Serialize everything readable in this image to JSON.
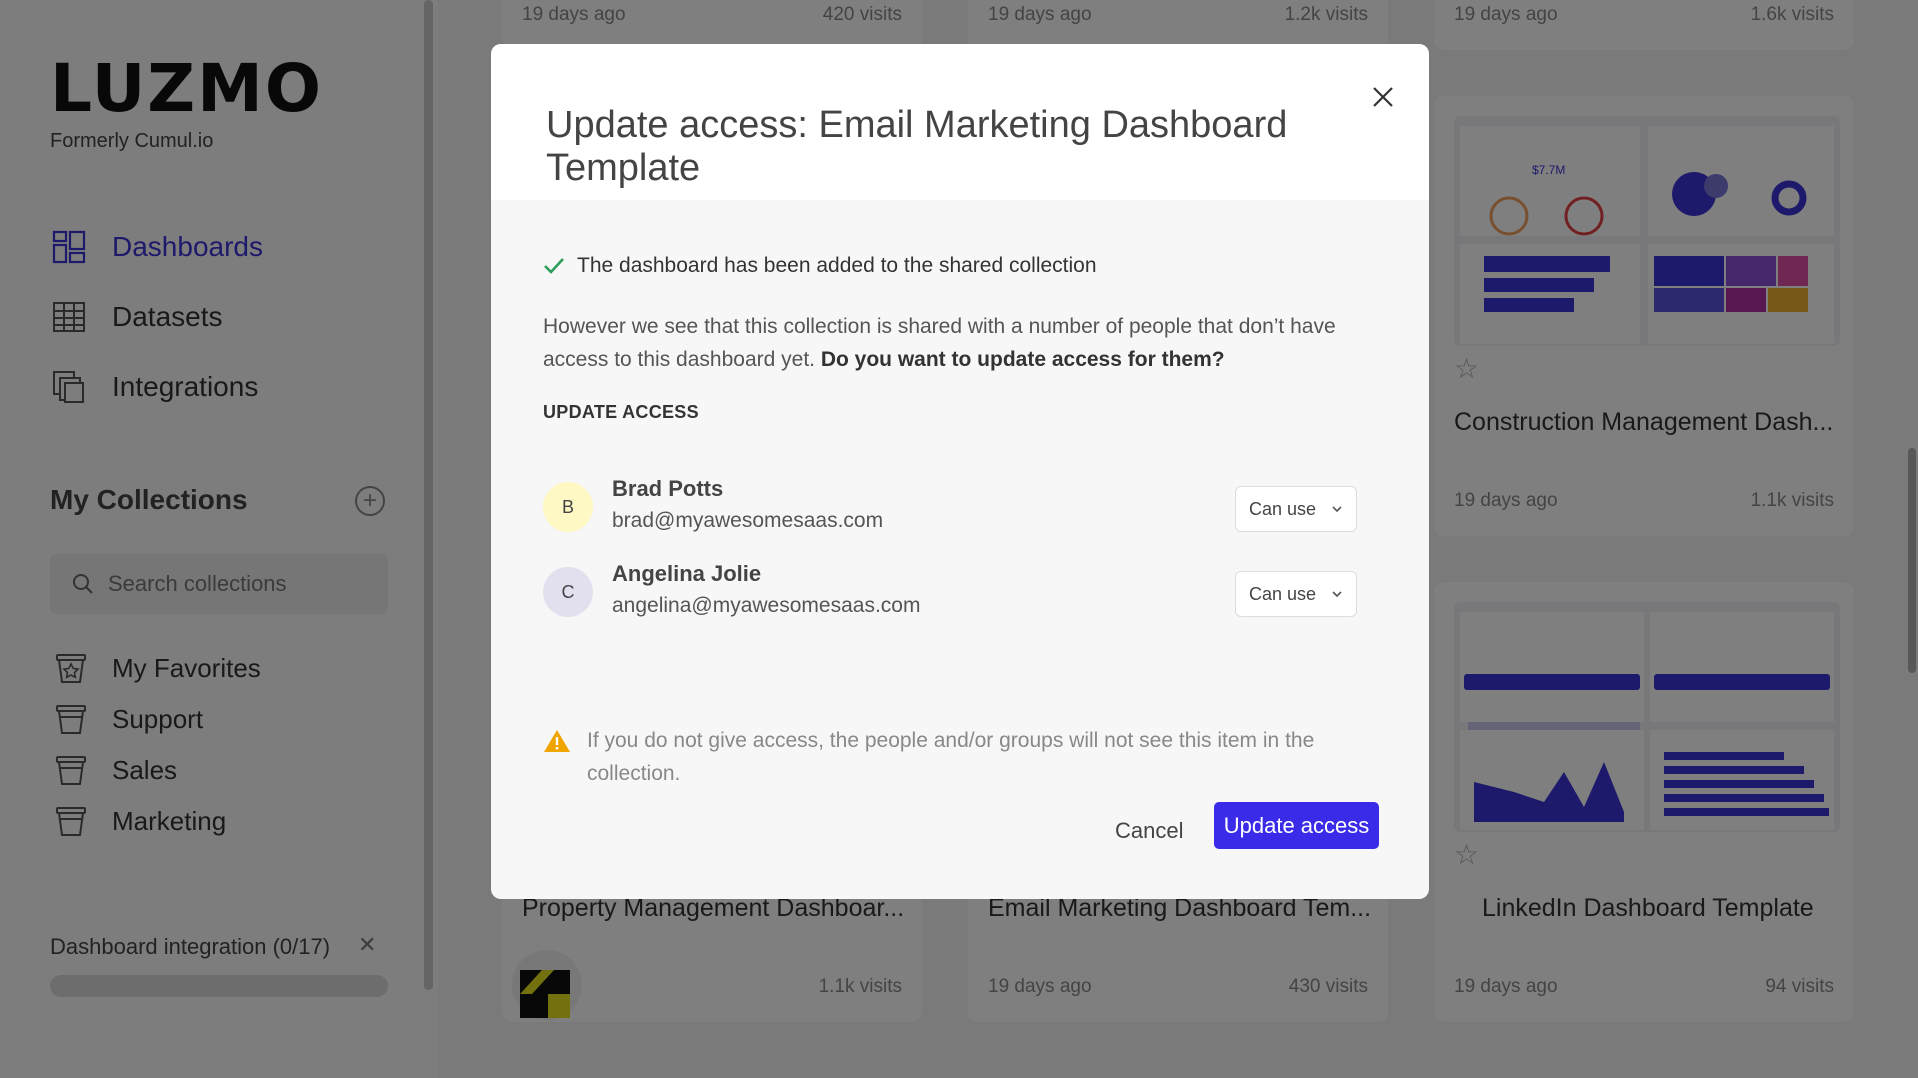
{
  "sidebar": {
    "logo": "LUZMO",
    "logo_sub": "Formerly Cumul.io",
    "nav": [
      {
        "label": "Dashboards",
        "icon": "dashboard-icon",
        "active": true
      },
      {
        "label": "Datasets",
        "icon": "table-icon",
        "active": false
      },
      {
        "label": "Integrations",
        "icon": "integrations-icon",
        "active": false
      }
    ],
    "collections_title": "My Collections",
    "search_placeholder": "Search collections",
    "collections": [
      {
        "label": "My Favorites",
        "icon": "favorites-basket-icon"
      },
      {
        "label": "Support",
        "icon": "basket-icon"
      },
      {
        "label": "Sales",
        "icon": "basket-icon"
      },
      {
        "label": "Marketing",
        "icon": "basket-icon"
      }
    ],
    "integration_label": "Dashboard integration (0/17)",
    "integration_progress": 0
  },
  "cards": {
    "top_row": [
      {
        "date": "19 days ago",
        "visits": "420 visits"
      },
      {
        "date": "19 days ago",
        "visits": "1.2k visits"
      },
      {
        "date": "19 days ago",
        "visits": "1.6k visits"
      }
    ],
    "construction": {
      "title": "Construction Management Dash...",
      "date": "19 days ago",
      "visits": "1.1k visits",
      "thumb_value": "$7.7M"
    },
    "bottom_row": [
      {
        "title": "Property Management Dashboar...",
        "date": "",
        "visits": "1.1k visits"
      },
      {
        "title": "Email Marketing Dashboard Tem...",
        "date": "19 days ago",
        "visits": "430 visits"
      },
      {
        "title": "LinkedIn Dashboard Template",
        "date": "19 days ago",
        "visits": "94 visits"
      }
    ]
  },
  "modal": {
    "title": "Update access: Email Marketing Dashboard Template",
    "success_message": "The dashboard has been added to the shared collection",
    "description": "However we see that this collection is shared with a number of people that don’t have access to this dashboard yet.",
    "description_strong": "Do you want to update access for them?",
    "section_label": "UPDATE ACCESS",
    "people": [
      {
        "initial": "B",
        "name": "Brad Potts",
        "email": "brad@myawesomesaas.com",
        "access": "Can use",
        "avatar_color": "#fdf8c4"
      },
      {
        "initial": "C",
        "name": "Angelina Jolie",
        "email": "angelina@myawesomesaas.com",
        "access": "Can use",
        "avatar_color": "#e2e0ef"
      }
    ],
    "warning": "If you do not give access, the people and/or groups will not see this item in the collection.",
    "cancel_label": "Cancel",
    "update_label": "Update access"
  },
  "colors": {
    "accent": "#3b32d6",
    "button": "#3a2be8",
    "success": "#2e9d5b",
    "warning": "#f0a400"
  }
}
